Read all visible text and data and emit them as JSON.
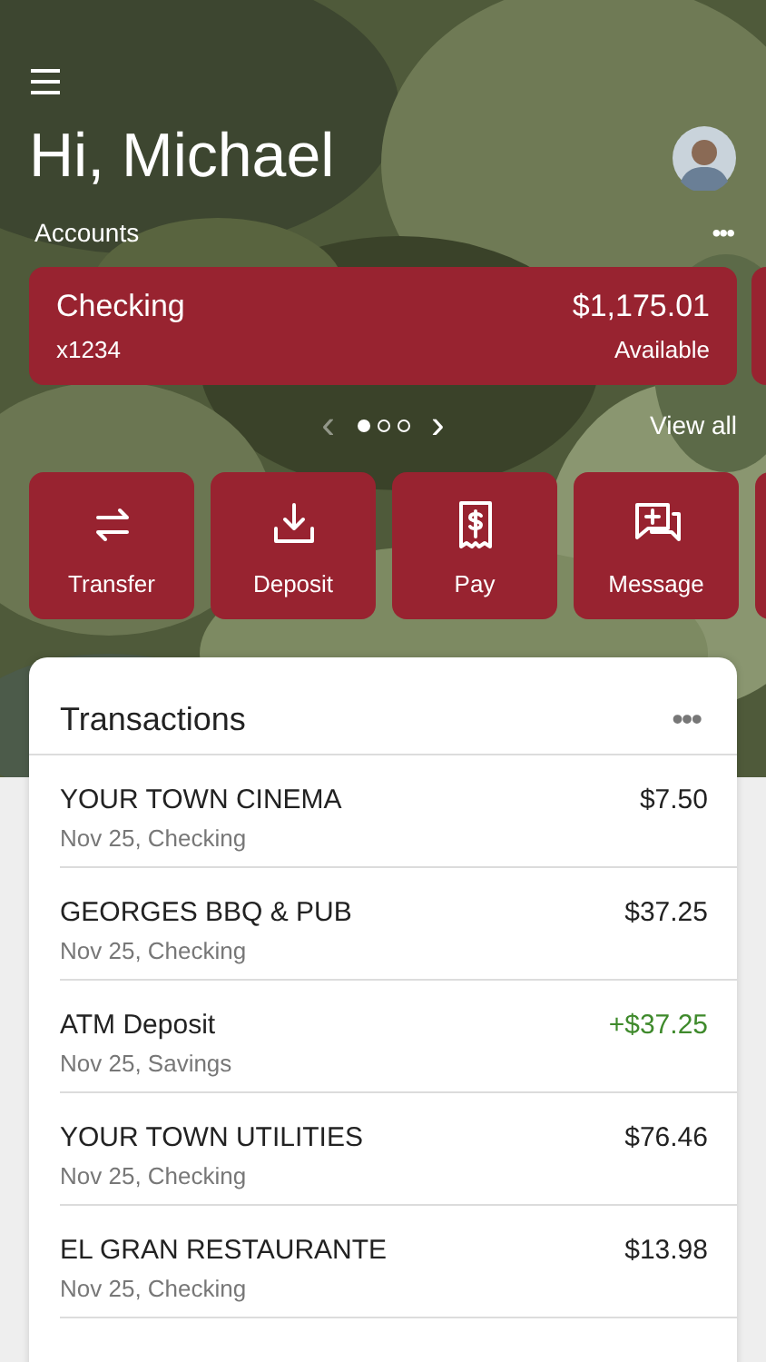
{
  "greeting": "Hi, Michael",
  "accounts_section": {
    "title": "Accounts",
    "more": "•••"
  },
  "accounts": [
    {
      "name": "Checking",
      "number": "x1234",
      "balance": "$1,175.01",
      "balance_label": "Available"
    }
  ],
  "pager": {
    "prev": "‹",
    "next": "›",
    "dots": [
      {
        "selected": true
      },
      {
        "selected": false
      },
      {
        "selected": false
      }
    ],
    "view_all": "View all"
  },
  "actions": [
    {
      "kind": "transfer",
      "label": "Transfer"
    },
    {
      "kind": "deposit",
      "label": "Deposit"
    },
    {
      "kind": "pay",
      "label": "Pay"
    },
    {
      "kind": "message",
      "label": "Message"
    }
  ],
  "transactions": {
    "title": "Transactions",
    "more": "•••",
    "rows": [
      {
        "payee": "YOUR TOWN CINEMA",
        "detail": "Nov 25, Checking",
        "amount": "$7.50",
        "kind": "debit"
      },
      {
        "payee": "GEORGES BBQ & PUB",
        "detail": "Nov 25, Checking",
        "amount": "$37.25",
        "kind": "debit"
      },
      {
        "payee": "ATM Deposit",
        "detail": "Nov 25, Savings",
        "amount": "+$37.25",
        "kind": "credit"
      },
      {
        "payee": "YOUR TOWN UTILITIES",
        "detail": "Nov 25, Checking",
        "amount": "$76.46",
        "kind": "debit"
      },
      {
        "payee": "EL GRAN RESTAURANTE",
        "detail": "Nov 25, Checking",
        "amount": "$13.98",
        "kind": "debit"
      }
    ]
  }
}
